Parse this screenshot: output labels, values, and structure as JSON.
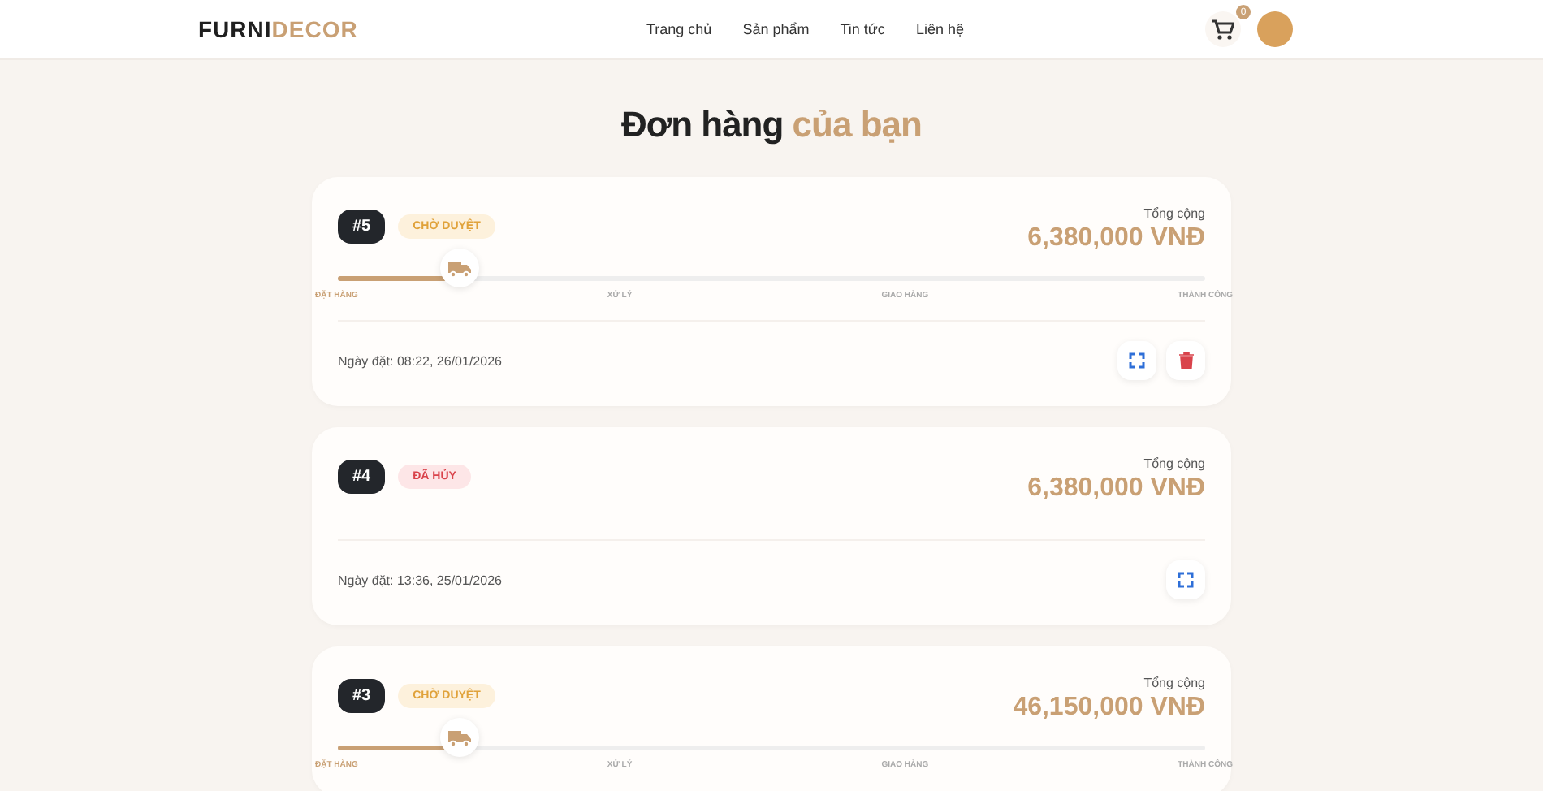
{
  "header": {
    "brand": [
      "FURNI",
      "DECOR"
    ],
    "nav": [
      {
        "label": "Trang chủ"
      },
      {
        "label": "Sản phẩm"
      },
      {
        "label": "Tin tức"
      },
      {
        "label": "Liên hệ"
      }
    ],
    "cart_count": "0"
  },
  "title": [
    "Đơn hàng",
    "của bạn"
  ],
  "orders": [
    {
      "number": "#5",
      "status": {
        "kind": "pending",
        "label": "CHỜ DUYỆT"
      },
      "total_label": "Tổng cộng",
      "total": "6,380,000 VNĐ",
      "progress": {
        "level": 0.14,
        "steps": [
          {
            "label": "ĐẶT HÀNG",
            "active": true
          },
          {
            "label": "XỬ LÝ",
            "active": false
          },
          {
            "label": "GIAO HÀNG",
            "active": false
          },
          {
            "label": "THÀNH CÔNG",
            "active": false
          }
        ]
      },
      "date": "Ngày đặt: 08:22, 26/01/2026",
      "actions": [
        {
          "kind": "expand"
        },
        {
          "kind": "delete"
        }
      ]
    },
    {
      "number": "#4",
      "status": {
        "kind": "cancelled",
        "label": "ĐÃ HỦY"
      },
      "total_label": "Tổng cộng",
      "total": "6,380,000 VNĐ",
      "date": "Ngày đặt: 13:36, 25/01/2026",
      "actions": [
        {
          "kind": "expand"
        }
      ]
    },
    {
      "number": "#3",
      "status": {
        "kind": "pending",
        "label": "CHỜ DUYỆT"
      },
      "total_label": "Tổng cộng",
      "total": "46,150,000 VNĐ",
      "progress": {
        "level": 0.14,
        "steps": [
          {
            "label": "ĐẶT HÀNG",
            "active": true
          },
          {
            "label": "XỬ LÝ",
            "active": false
          },
          {
            "label": "GIAO HÀNG",
            "active": false
          },
          {
            "label": "THÀNH CÔNG",
            "active": false
          }
        ]
      }
    }
  ]
}
